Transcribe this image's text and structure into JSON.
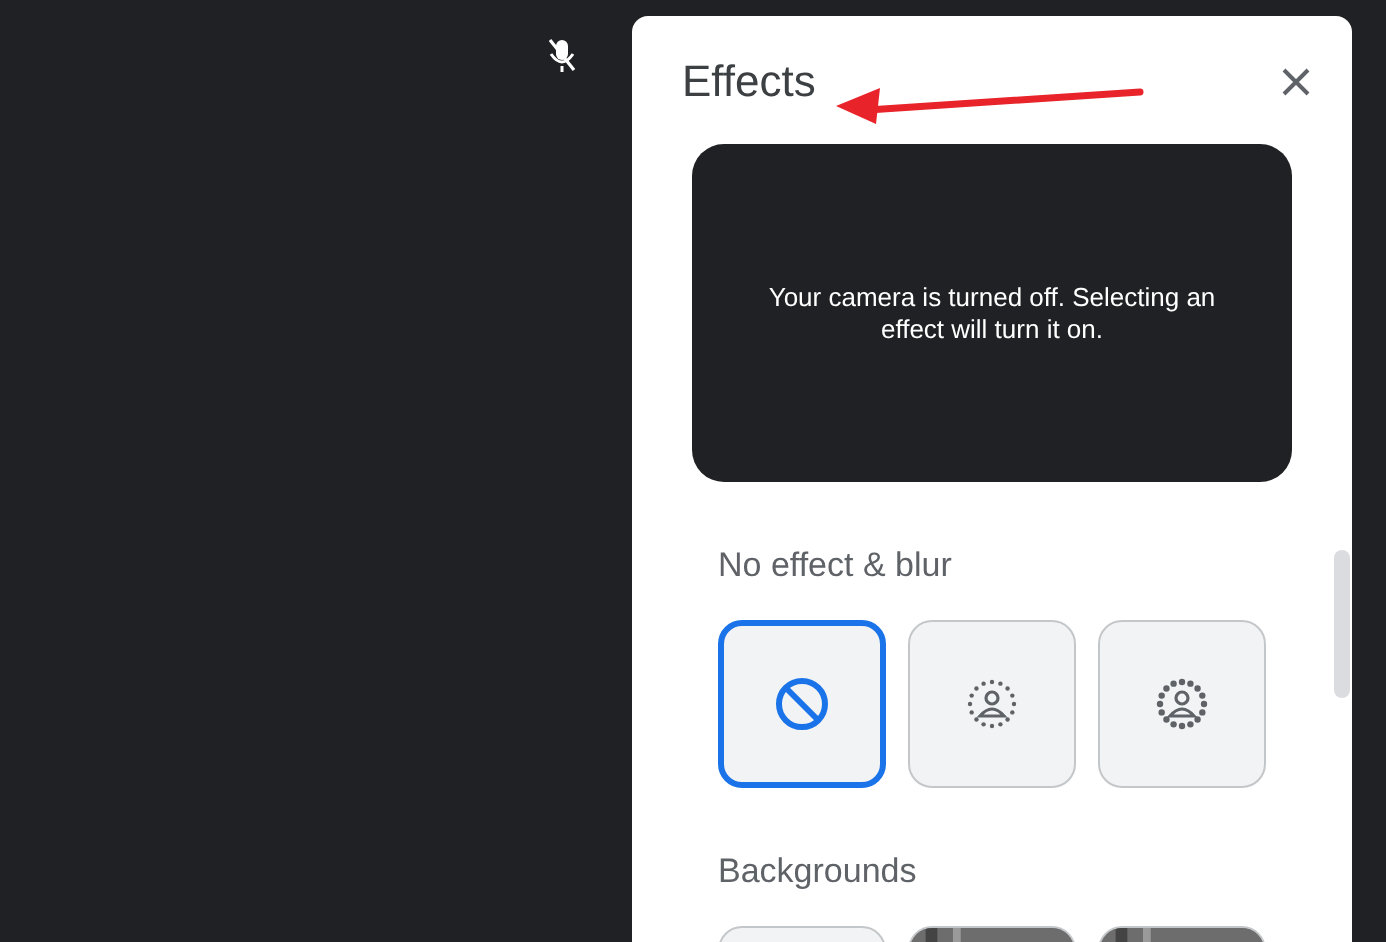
{
  "meeting": {
    "mic_muted": true
  },
  "panel": {
    "title": "Effects",
    "preview_message": "Your camera is turned off. Selecting an effect will turn it on.",
    "sections": [
      {
        "heading": "No effect & blur",
        "tiles": [
          {
            "kind": "none",
            "selected": true
          },
          {
            "kind": "slight-blur",
            "selected": false
          },
          {
            "kind": "blur",
            "selected": false
          }
        ]
      },
      {
        "heading": "Backgrounds",
        "tiles": [
          {
            "kind": "plain",
            "selected": false
          },
          {
            "kind": "picture",
            "selected": false
          },
          {
            "kind": "picture",
            "selected": false
          }
        ]
      }
    ]
  },
  "annotation": {
    "kind": "arrow"
  }
}
